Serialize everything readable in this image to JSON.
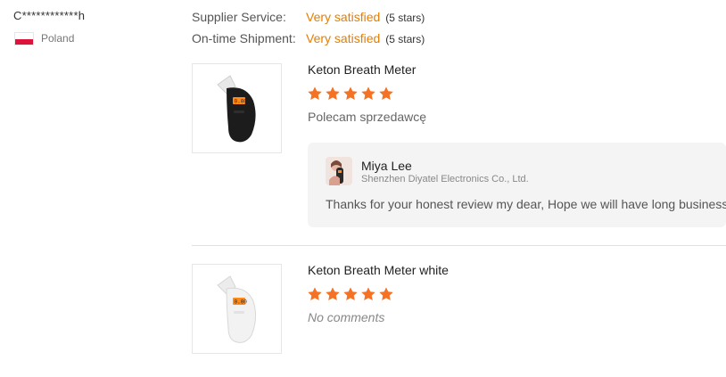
{
  "reviewer": {
    "name": "C************h",
    "country": "Poland"
  },
  "ratings": [
    {
      "label": "Supplier Service:",
      "value": "Very satisfied",
      "stars_text": "(5 stars)"
    },
    {
      "label": "On-time Shipment:",
      "value": "Very satisfied",
      "stars_text": "(5 stars)"
    }
  ],
  "reviews": [
    {
      "product_title": "Keton Breath Meter",
      "stars": 5,
      "comment": "Polecam sprzedawcę",
      "product_color": "black",
      "reply": {
        "seller_name": "Miya Lee",
        "seller_company": "Shenzhen Diyatel Electronics Co., Ltd.",
        "text": "Thanks for your honest review my dear, Hope we will have long business!"
      }
    },
    {
      "product_title": "Keton Breath Meter white",
      "stars": 5,
      "comment": "No comments",
      "product_color": "white"
    }
  ],
  "colors": {
    "accent": "#e67e00",
    "star": "#f57224",
    "flag_red": "#dc143c"
  }
}
